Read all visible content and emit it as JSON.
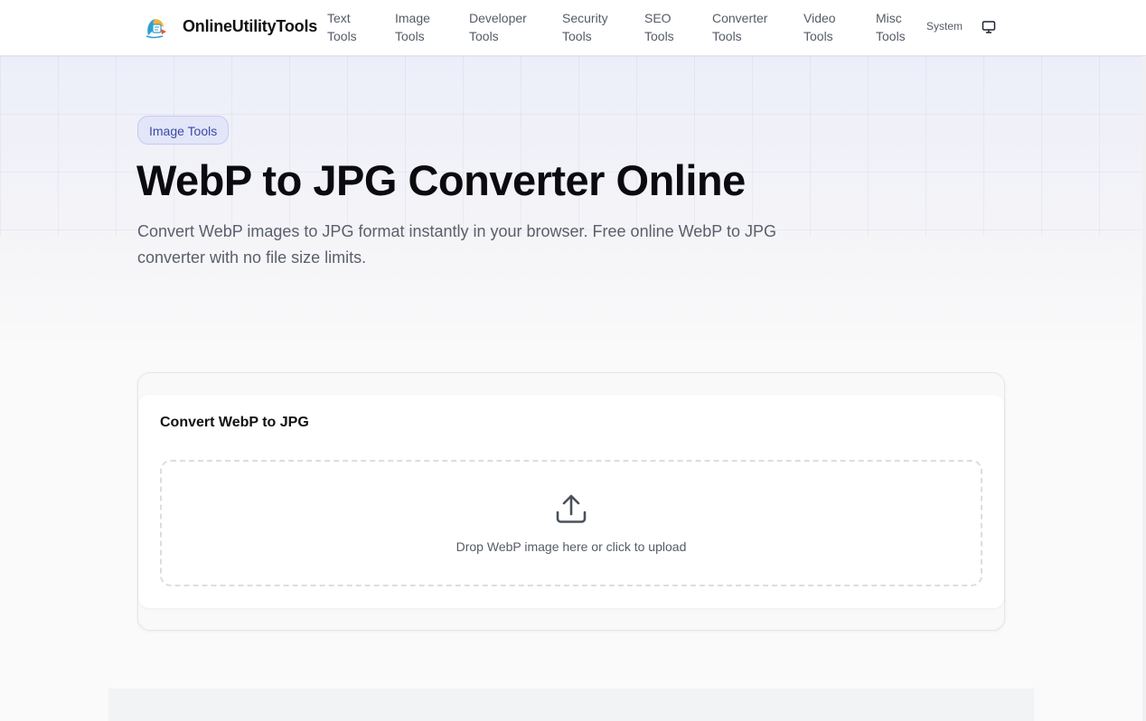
{
  "header": {
    "brand": "OnlineUtilityTools",
    "nav": [
      {
        "line1": "Text",
        "line2": "Tools"
      },
      {
        "line1": "Image",
        "line2": "Tools"
      },
      {
        "line1": "Developer",
        "line2": "Tools"
      },
      {
        "line1": "Security",
        "line2": "Tools"
      },
      {
        "line1": "SEO",
        "line2": "Tools"
      },
      {
        "line1": "Converter",
        "line2": "Tools"
      },
      {
        "line1": "Video",
        "line2": "Tools"
      },
      {
        "line1": "Misc",
        "line2": "Tools"
      }
    ],
    "theme_label": "System",
    "theme_icon": "monitor-icon"
  },
  "hero": {
    "badge": "Image Tools",
    "title": "WebP to JPG Converter Online",
    "description": "Convert WebP images to JPG format instantly in your browser. Free online WebP to JPG converter with no file size limits."
  },
  "converter": {
    "title": "Convert WebP to JPG",
    "dropzone_text": "Drop WebP image here or click to upload",
    "upload_icon": "upload-icon"
  },
  "colors": {
    "accent": "#3a4aa6",
    "badge_bg": "#e3e6f8",
    "text_primary": "#0b0b0f",
    "text_secondary": "#5a5f6b"
  }
}
